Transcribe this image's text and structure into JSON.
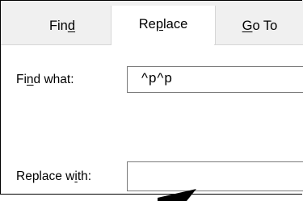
{
  "dialog": {
    "tabs": [
      {
        "pre": "Fin",
        "key": "d",
        "post": ""
      },
      {
        "pre": "Re",
        "key": "p",
        "post": "lace"
      },
      {
        "pre": "",
        "key": "G",
        "post": "o To"
      }
    ],
    "find_label": {
      "pre": "Fi",
      "key": "n",
      "post": "d what:"
    },
    "find_value": "^p^p",
    "replace_label": {
      "pre": "Replace w",
      "key": "i",
      "post": "th:"
    },
    "replace_value": ""
  }
}
